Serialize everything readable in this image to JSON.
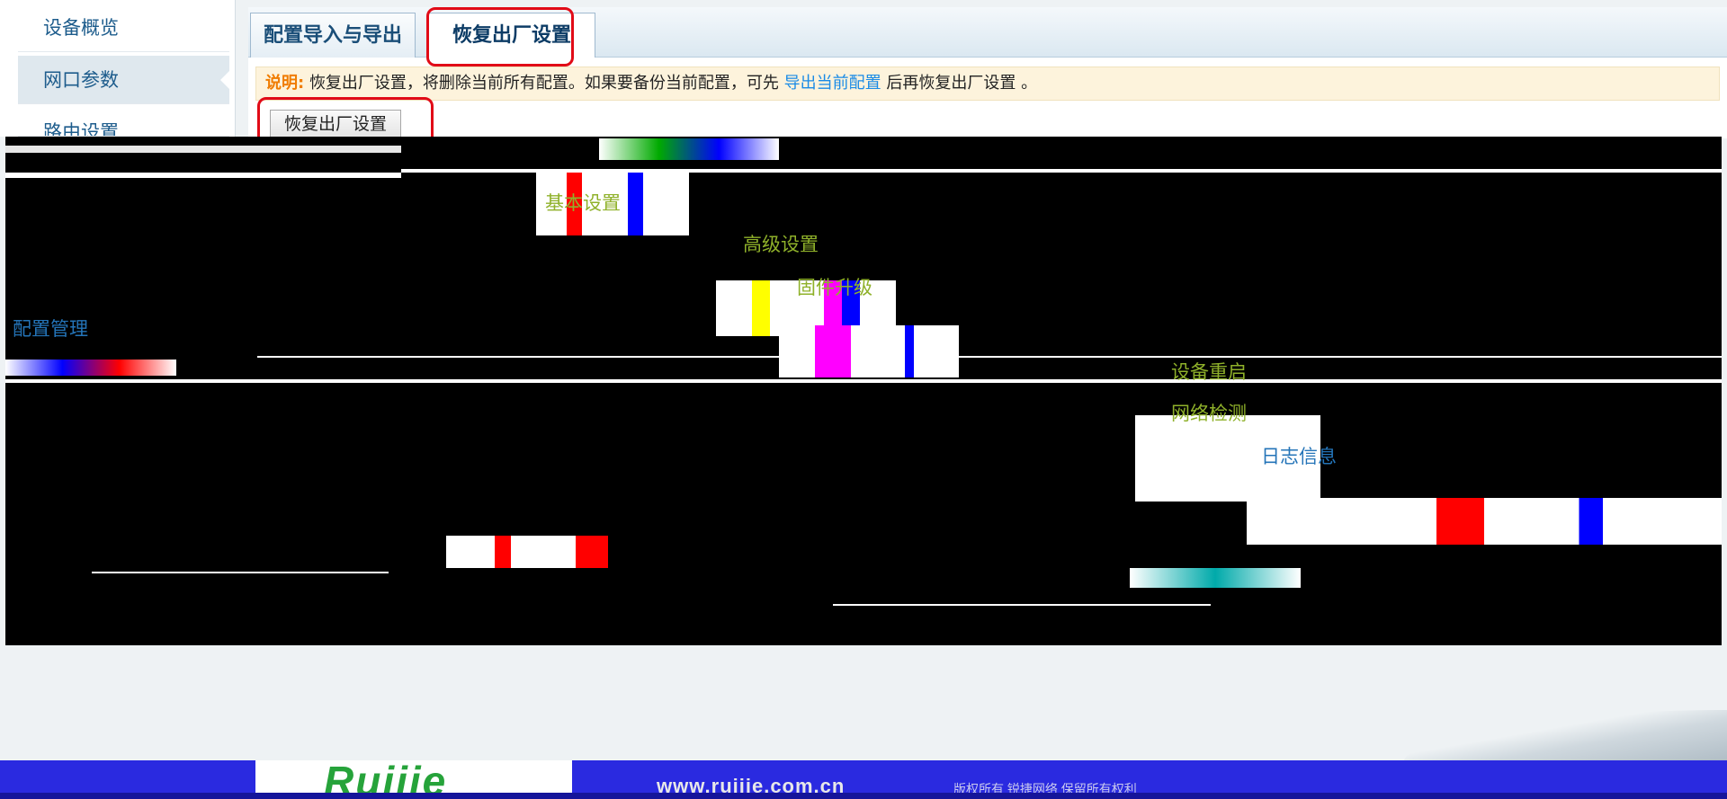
{
  "sidebar": {
    "items": [
      {
        "label": "设备概览"
      },
      {
        "label": "网口参数"
      },
      {
        "label": "路由设置"
      }
    ]
  },
  "tabs": [
    {
      "label": "配置导入与导出"
    },
    {
      "label": "恢复出厂设置"
    }
  ],
  "notice": {
    "label": "说明:",
    "text_before": "恢复出厂设置，将删除当前所有配置。如果要备份当前配置，可先",
    "link": "导出当前配置",
    "text_after": "后再恢复出厂设置 。"
  },
  "restore_button": {
    "label": "恢复出厂设置"
  },
  "corrupted_menu": {
    "items": [
      {
        "label": "基本设置"
      },
      {
        "label": "高级设置"
      },
      {
        "label": "固件升级"
      },
      {
        "label": "配置管理"
      },
      {
        "label": "设备重启"
      },
      {
        "label": "网络检测"
      },
      {
        "label": "日志信息"
      }
    ]
  },
  "footer": {
    "logo": "Ruijie",
    "url": "www.ruijie.com.cn",
    "copyright": "版权所有 锐捷网络 保留所有权利"
  },
  "colors": {
    "accent": "#1a4e78",
    "highlight": "#e10b17",
    "notice_label": "#f07c00",
    "link": "#1a8be6",
    "footer": "#2a2ae0",
    "logo": "#26a33a"
  }
}
